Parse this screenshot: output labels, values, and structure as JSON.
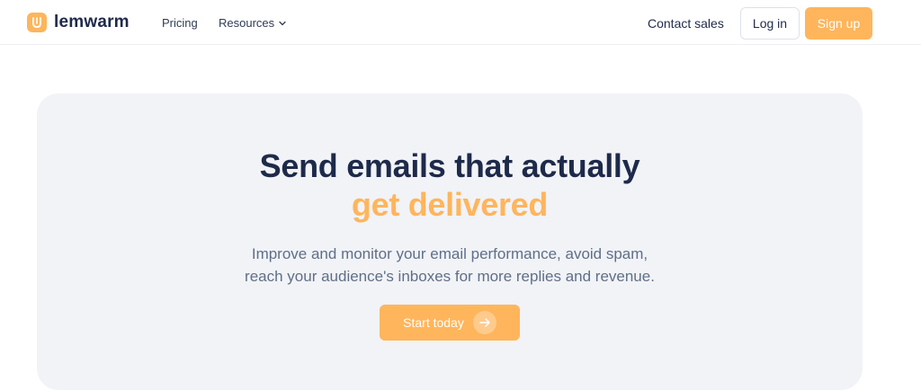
{
  "brand": {
    "name": "lemwarm",
    "accent_color": "#ffb55c",
    "text_color": "#1e2a4a"
  },
  "nav": {
    "pricing": "Pricing",
    "resources": "Resources",
    "contact_sales": "Contact sales",
    "log_in": "Log in",
    "sign_up": "Sign up"
  },
  "hero": {
    "headline_line1": "Send emails that actually",
    "headline_line2": "get delivered",
    "subtitle_line1": "Improve and monitor your email performance, avoid spam,",
    "subtitle_line2": "reach your audience's inboxes for more replies and revenue.",
    "cta_label": "Start today"
  }
}
